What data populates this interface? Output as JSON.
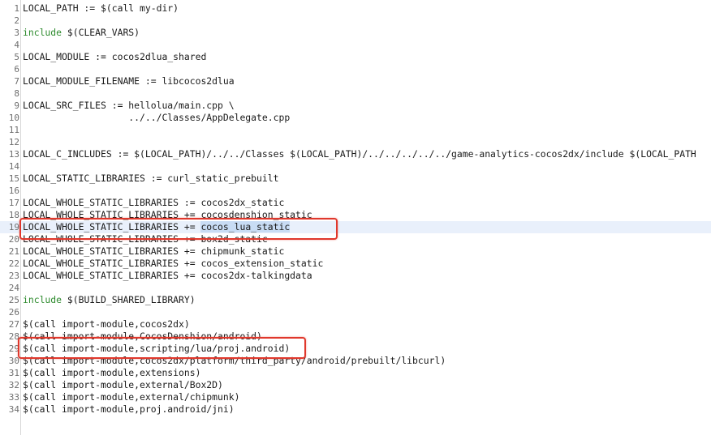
{
  "editor": {
    "lines": [
      {
        "n": "1",
        "segs": [
          {
            "t": "LOCAL_PATH := $(call my-dir)"
          }
        ]
      },
      {
        "n": "2",
        "segs": []
      },
      {
        "n": "3",
        "segs": [
          {
            "t": "include",
            "kw": true
          },
          {
            "t": " $(CLEAR_VARS)"
          }
        ]
      },
      {
        "n": "4",
        "segs": []
      },
      {
        "n": "5",
        "segs": [
          {
            "t": "LOCAL_MODULE := cocos2dlua_shared"
          }
        ]
      },
      {
        "n": "6",
        "segs": []
      },
      {
        "n": "7",
        "segs": [
          {
            "t": "LOCAL_MODULE_FILENAME := libcocos2dlua"
          }
        ]
      },
      {
        "n": "8",
        "segs": []
      },
      {
        "n": "9",
        "segs": [
          {
            "t": "LOCAL_SRC_FILES := hellolua/main.cpp \\"
          }
        ]
      },
      {
        "n": "10",
        "segs": [
          {
            "t": "                   ../../Classes/AppDelegate.cpp"
          }
        ]
      },
      {
        "n": "11",
        "segs": []
      },
      {
        "n": "12",
        "segs": []
      },
      {
        "n": "13",
        "segs": [
          {
            "t": "LOCAL_C_INCLUDES := $(LOCAL_PATH)/../../Classes $(LOCAL_PATH)/../../../../../game-analytics-cocos2dx/include $(LOCAL_PATH"
          }
        ]
      },
      {
        "n": "14",
        "segs": []
      },
      {
        "n": "15",
        "segs": [
          {
            "t": "LOCAL_STATIC_LIBRARIES := curl_static_prebuilt"
          }
        ]
      },
      {
        "n": "16",
        "segs": []
      },
      {
        "n": "17",
        "segs": [
          {
            "t": "LOCAL_WHOLE_STATIC_LIBRARIES := cocos2dx_static"
          }
        ]
      },
      {
        "n": "18",
        "segs": [
          {
            "t": "LOCAL_WHOLE_STATIC_LIBRARIES += cocosdenshion_static"
          }
        ]
      },
      {
        "n": "19",
        "segs": [
          {
            "t": "LOCAL_WHOLE_STATIC_LIBRARIES += "
          },
          {
            "t": "cocos_lua_static",
            "sel": true
          }
        ],
        "current": true
      },
      {
        "n": "20",
        "segs": [
          {
            "t": "LOCAL_WHOLE_STATIC_LIBRARIES += box2d_static"
          }
        ]
      },
      {
        "n": "21",
        "segs": [
          {
            "t": "LOCAL_WHOLE_STATIC_LIBRARIES += chipmunk_static"
          }
        ]
      },
      {
        "n": "22",
        "segs": [
          {
            "t": "LOCAL_WHOLE_STATIC_LIBRARIES += cocos_extension_static"
          }
        ]
      },
      {
        "n": "23",
        "segs": [
          {
            "t": "LOCAL_WHOLE_STATIC_LIBRARIES += cocos2dx-talkingdata"
          }
        ]
      },
      {
        "n": "24",
        "segs": []
      },
      {
        "n": "25",
        "segs": [
          {
            "t": "include",
            "kw": true
          },
          {
            "t": " $(BUILD_SHARED_LIBRARY)"
          }
        ]
      },
      {
        "n": "26",
        "segs": []
      },
      {
        "n": "27",
        "segs": [
          {
            "t": "$(call import-module,cocos2dx)"
          }
        ]
      },
      {
        "n": "28",
        "segs": [
          {
            "t": "$(call import-module,CocosDenshion/android)"
          }
        ]
      },
      {
        "n": "29",
        "segs": [
          {
            "t": "$(call import-module,scripting/lua/proj.android)"
          }
        ]
      },
      {
        "n": "30",
        "segs": [
          {
            "t": "$(call import-module,cocos2dx/platform/third_party/android/prebuilt/libcurl)"
          }
        ]
      },
      {
        "n": "31",
        "segs": [
          {
            "t": "$(call import-module,extensions)"
          }
        ]
      },
      {
        "n": "32",
        "segs": [
          {
            "t": "$(call import-module,external/Box2D)"
          }
        ]
      },
      {
        "n": "33",
        "segs": [
          {
            "t": "$(call import-module,external/chipmunk)"
          }
        ]
      },
      {
        "n": "34",
        "segs": [
          {
            "t": "$(call import-module,proj.android/jni)"
          }
        ]
      }
    ]
  },
  "colors": {
    "keyword": "#2e8b2e",
    "highlight_box": "#e0382c",
    "selection": "#c8dcf4",
    "current_line": "#e9f0fb"
  }
}
